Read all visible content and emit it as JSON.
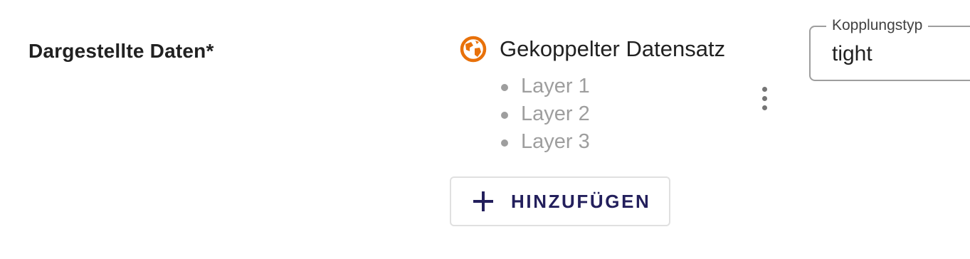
{
  "field": {
    "label": "Dargestellte Daten*"
  },
  "dataset": {
    "icon": "globe-icon",
    "icon_color": "#e8710a",
    "title": "Gekoppelter Datensatz",
    "layers": [
      "Layer 1",
      "Layer 2",
      "Layer 3"
    ]
  },
  "actions": {
    "menu_icon": "more-vert-icon",
    "add_icon": "plus-icon",
    "add_label": "HINZUFÜGEN",
    "add_color": "#231f5c"
  },
  "coupling": {
    "label": "Kopplungstyp",
    "value": "tight"
  }
}
